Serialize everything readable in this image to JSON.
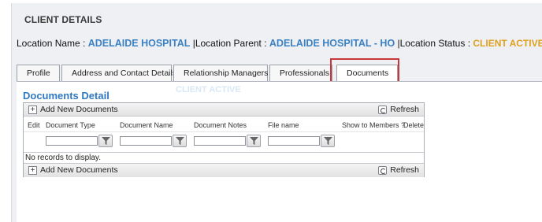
{
  "panel": {
    "title": "CLIENT DETAILS"
  },
  "location": {
    "name_label": "Location Name :",
    "name_value": "ADELAIDE HOSPITAL",
    "parent_label": "|Location Parent :",
    "parent_value": "ADELAIDE HOSPITAL - HO",
    "status_label": "|Location Status :",
    "status_value": "CLIENT ACTIVE"
  },
  "tabs": [
    {
      "label": "Profile"
    },
    {
      "label": "Address and Contact Details"
    },
    {
      "label": "Relationship Managers"
    },
    {
      "label": "Professionals"
    },
    {
      "label": "Documents"
    }
  ],
  "ghost_text": "CLIENT ACTIVE",
  "documents": {
    "title": "Documents Detail",
    "add_label": "Add New Documents",
    "refresh_label": "Refresh",
    "columns": [
      "Edit",
      "Document Type",
      "Document Name",
      "Document Notes",
      "File name",
      "Show to Members ?",
      "Delete"
    ],
    "empty_text": "No records to display."
  },
  "colors": {
    "accent": "#3b82c4",
    "status": "#e0a020",
    "highlight": "#c8373a",
    "title_blue": "#2f79c2"
  },
  "icons": {
    "add": "plus-icon",
    "refresh": "refresh-icon",
    "filter": "filter-icon"
  }
}
